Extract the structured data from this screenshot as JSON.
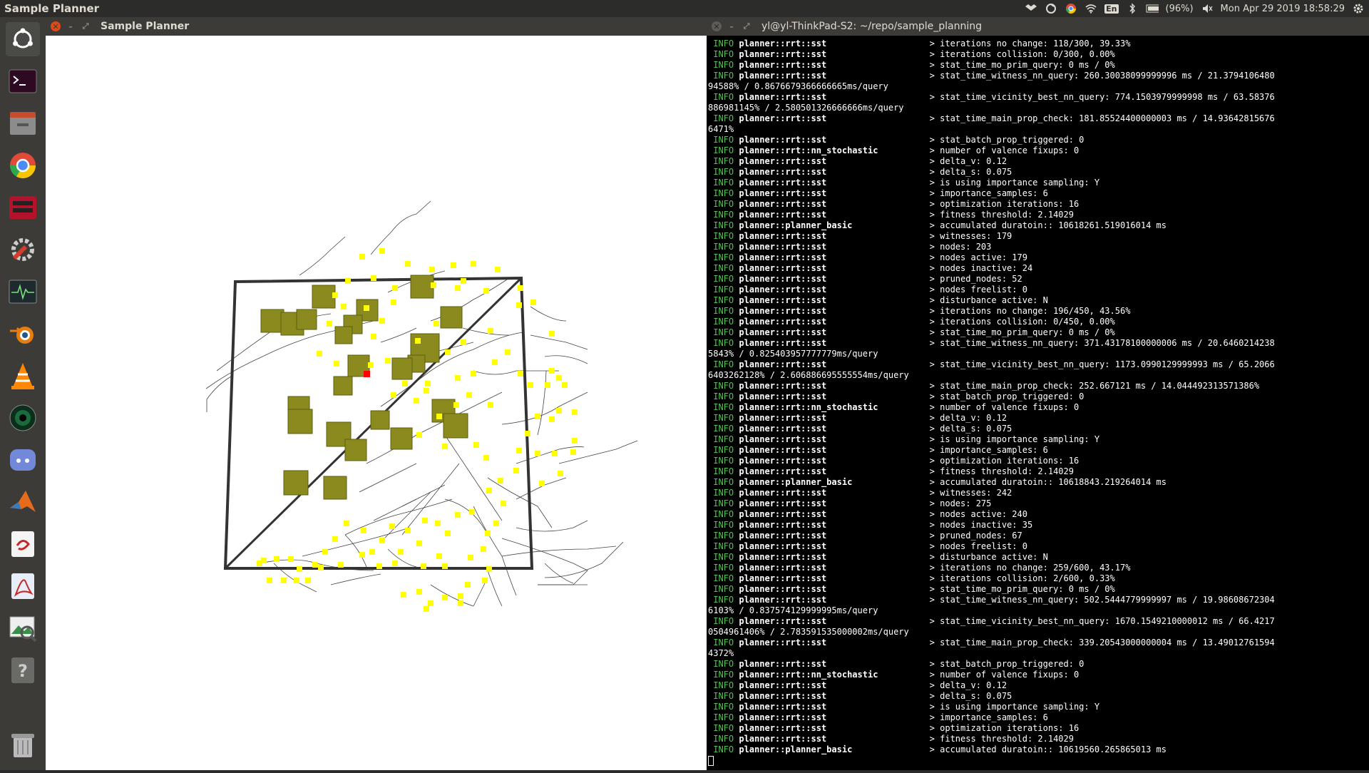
{
  "topbar": {
    "app_title": "Sample Planner",
    "battery": "(96%)",
    "keyboard": "En",
    "datetime": "Mon Apr 29 2019 18:58:29"
  },
  "launcher": {
    "items": [
      "ubuntu-dash-icon",
      "terminal-icon",
      "files-icon",
      "chrome-icon",
      "game-icon",
      "settings-icon",
      "system-monitor-icon",
      "blender-icon",
      "vlc-icon",
      "camera-icon",
      "discord-icon",
      "matlab-icon",
      "ebook-icon",
      "pdf-icon",
      "image-viewer-icon",
      "help-icon",
      "trash-icon"
    ]
  },
  "left_window": {
    "title": "Sample Planner"
  },
  "terminal_window": {
    "title": "yl@yl-ThinkPad-S2: ~/repo/sample_planning",
    "lines": [
      {
        "k": "i",
        "m": "planner::rrt::sst",
        "t": "> iterations no change: 118/300, 39.33%"
      },
      {
        "k": "i",
        "m": "planner::rrt::sst",
        "t": "> iterations collision: 0/300, 0.00%"
      },
      {
        "k": "i",
        "m": "planner::rrt::sst",
        "t": "> stat_time_mo_prim_query: 0 ms / 0%"
      },
      {
        "k": "i",
        "m": "planner::rrt::sst",
        "t": "> stat_time_witness_nn_query: 260.30038099999996 ms / 21.3794106480"
      },
      {
        "k": "c",
        "t": "94588% / 0.8676679366666665ms/query"
      },
      {
        "k": "i",
        "m": "planner::rrt::sst",
        "t": "> stat_time_vicinity_best_nn_query: 774.1503979999998 ms / 63.58376"
      },
      {
        "k": "c",
        "t": "886981145% / 2.580501326666666ms/query"
      },
      {
        "k": "i",
        "m": "planner::rrt::sst",
        "t": "> stat_time_main_prop_check: 181.85524400000003 ms / 14.93642815676"
      },
      {
        "k": "c",
        "t": "6471%"
      },
      {
        "k": "i",
        "m": "planner::rrt::sst",
        "t": "> stat_batch_prop_triggered: 0"
      },
      {
        "k": "i",
        "m": "planner::rrt::nn_stochastic",
        "t": "> number of valence fixups: 0"
      },
      {
        "k": "i",
        "m": "planner::rrt::sst",
        "t": "> delta_v: 0.12"
      },
      {
        "k": "i",
        "m": "planner::rrt::sst",
        "t": "> delta_s: 0.075"
      },
      {
        "k": "i",
        "m": "planner::rrt::sst",
        "t": "> is using importance sampling: Y"
      },
      {
        "k": "i",
        "m": "planner::rrt::sst",
        "t": "> importance_samples: 6"
      },
      {
        "k": "i",
        "m": "planner::rrt::sst",
        "t": "> optimization iterations: 16"
      },
      {
        "k": "i",
        "m": "planner::rrt::sst",
        "t": "> fitness threshold: 2.14029"
      },
      {
        "k": "i",
        "m": "planner::planner_basic",
        "t": "> accumulated duratoin:: 10618261.519016014 ms"
      },
      {
        "k": "i",
        "m": "planner::rrt::sst",
        "t": "> witnesses: 179"
      },
      {
        "k": "i",
        "m": "planner::rrt::sst",
        "t": "> nodes: 203"
      },
      {
        "k": "i",
        "m": "planner::rrt::sst",
        "t": "> nodes active: 179"
      },
      {
        "k": "i",
        "m": "planner::rrt::sst",
        "t": "> nodes inactive: 24"
      },
      {
        "k": "i",
        "m": "planner::rrt::sst",
        "t": "> pruned_nodes: 52"
      },
      {
        "k": "i",
        "m": "planner::rrt::sst",
        "t": "> nodes freelist: 0"
      },
      {
        "k": "i",
        "m": "planner::rrt::sst",
        "t": "> disturbance active: N"
      },
      {
        "k": "i",
        "m": "planner::rrt::sst",
        "t": "> iterations no change: 196/450, 43.56%"
      },
      {
        "k": "i",
        "m": "planner::rrt::sst",
        "t": "> iterations collision: 0/450, 0.00%"
      },
      {
        "k": "i",
        "m": "planner::rrt::sst",
        "t": "> stat_time_mo_prim_query: 0 ms / 0%"
      },
      {
        "k": "i",
        "m": "planner::rrt::sst",
        "t": "> stat_time_witness_nn_query: 371.43178100000006 ms / 20.6460214238"
      },
      {
        "k": "c",
        "t": "5843% / 0.825403957777779ms/query"
      },
      {
        "k": "i",
        "m": "planner::rrt::sst",
        "t": "> stat_time_vicinity_best_nn_query: 1173.0990129999993 ms / 65.2066"
      },
      {
        "k": "c",
        "t": "6403262128% / 2.606886695555554ms/query"
      },
      {
        "k": "i",
        "m": "planner::rrt::sst",
        "t": "> stat_time_main_prop_check: 252.667121 ms / 14.044492313571386%"
      },
      {
        "k": "i",
        "m": "planner::rrt::sst",
        "t": "> stat_batch_prop_triggered: 0"
      },
      {
        "k": "i",
        "m": "planner::rrt::nn_stochastic",
        "t": "> number of valence fixups: 0"
      },
      {
        "k": "i",
        "m": "planner::rrt::sst",
        "t": "> delta_v: 0.12"
      },
      {
        "k": "i",
        "m": "planner::rrt::sst",
        "t": "> delta_s: 0.075"
      },
      {
        "k": "i",
        "m": "planner::rrt::sst",
        "t": "> is using importance sampling: Y"
      },
      {
        "k": "i",
        "m": "planner::rrt::sst",
        "t": "> importance_samples: 6"
      },
      {
        "k": "i",
        "m": "planner::rrt::sst",
        "t": "> optimization iterations: 16"
      },
      {
        "k": "i",
        "m": "planner::rrt::sst",
        "t": "> fitness threshold: 2.14029"
      },
      {
        "k": "i",
        "m": "planner::planner_basic",
        "t": "> accumulated duratoin:: 10618843.219264014 ms"
      },
      {
        "k": "i",
        "m": "planner::rrt::sst",
        "t": "> witnesses: 242"
      },
      {
        "k": "i",
        "m": "planner::rrt::sst",
        "t": "> nodes: 275"
      },
      {
        "k": "i",
        "m": "planner::rrt::sst",
        "t": "> nodes active: 240"
      },
      {
        "k": "i",
        "m": "planner::rrt::sst",
        "t": "> nodes inactive: 35"
      },
      {
        "k": "i",
        "m": "planner::rrt::sst",
        "t": "> pruned_nodes: 67"
      },
      {
        "k": "i",
        "m": "planner::rrt::sst",
        "t": "> nodes freelist: 0"
      },
      {
        "k": "i",
        "m": "planner::rrt::sst",
        "t": "> disturbance active: N"
      },
      {
        "k": "i",
        "m": "planner::rrt::sst",
        "t": "> iterations no change: 259/600, 43.17%"
      },
      {
        "k": "i",
        "m": "planner::rrt::sst",
        "t": "> iterations collision: 2/600, 0.33%"
      },
      {
        "k": "i",
        "m": "planner::rrt::sst",
        "t": "> stat_time_mo_prim_query: 0 ms / 0%"
      },
      {
        "k": "i",
        "m": "planner::rrt::sst",
        "t": "> stat_time_witness_nn_query: 502.5444779999997 ms / 19.98608672304"
      },
      {
        "k": "c",
        "t": "6103% / 0.837574129999995ms/query"
      },
      {
        "k": "i",
        "m": "planner::rrt::sst",
        "t": "> stat_time_vicinity_best_nn_query: 1670.1549210000012 ms / 66.4217"
      },
      {
        "k": "c",
        "t": "0504961406% / 2.783591535000002ms/query"
      },
      {
        "k": "i",
        "m": "planner::rrt::sst",
        "t": "> stat_time_main_prop_check: 339.20543000000004 ms / 13.49012761594"
      },
      {
        "k": "c",
        "t": "4372%"
      },
      {
        "k": "i",
        "m": "planner::rrt::sst",
        "t": "> stat_batch_prop_triggered: 0"
      },
      {
        "k": "i",
        "m": "planner::rrt::nn_stochastic",
        "t": "> number of valence fixups: 0"
      },
      {
        "k": "i",
        "m": "planner::rrt::sst",
        "t": "> delta_v: 0.12"
      },
      {
        "k": "i",
        "m": "planner::rrt::sst",
        "t": "> delta_s: 0.075"
      },
      {
        "k": "i",
        "m": "planner::rrt::sst",
        "t": "> is using importance sampling: Y"
      },
      {
        "k": "i",
        "m": "planner::rrt::sst",
        "t": "> importance_samples: 6"
      },
      {
        "k": "i",
        "m": "planner::rrt::sst",
        "t": "> optimization iterations: 16"
      },
      {
        "k": "i",
        "m": "planner::rrt::sst",
        "t": "> fitness threshold: 2.14029"
      },
      {
        "k": "i",
        "m": "planner::planner_basic",
        "t": "> accumulated duratoin:: 10619560.265865013 ms"
      }
    ]
  },
  "colors": {
    "info": "#4ec64e",
    "obstacle": "#8a8a1e",
    "sample": "#ffff00",
    "goal": "#ff0000"
  }
}
